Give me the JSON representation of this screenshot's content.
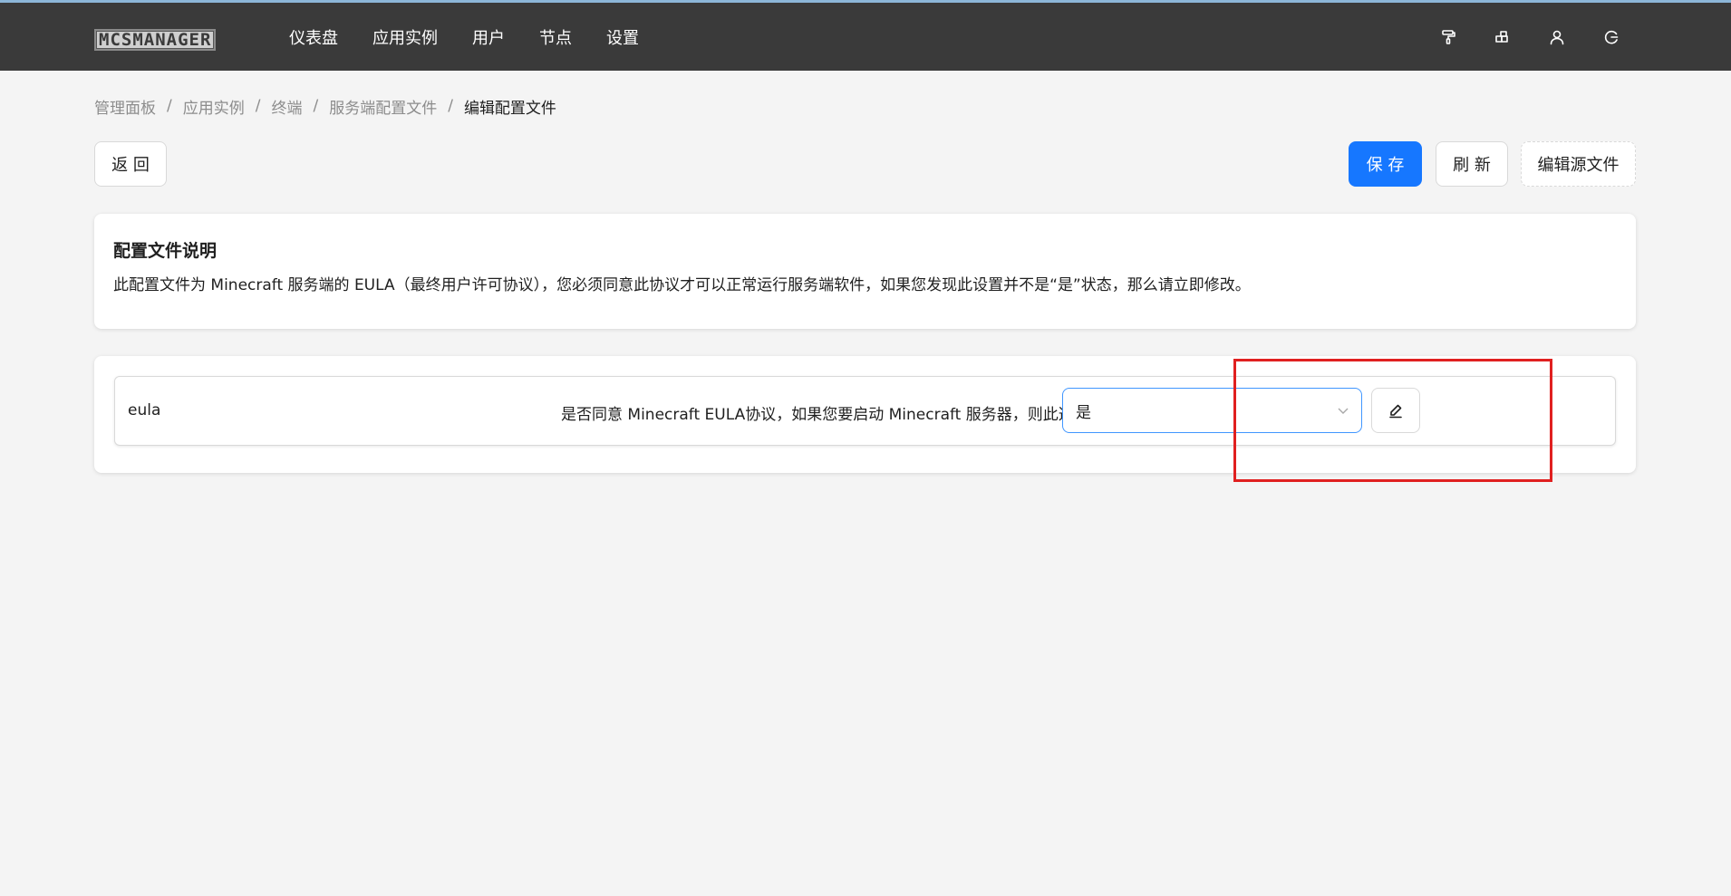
{
  "header": {
    "logo_text": "MCSMANAGER",
    "nav": [
      {
        "label": "仪表盘"
      },
      {
        "label": "应用实例"
      },
      {
        "label": "用户"
      },
      {
        "label": "节点"
      },
      {
        "label": "设置"
      }
    ],
    "tools": [
      {
        "icon": "paint-roller-icon"
      },
      {
        "icon": "puzzle-icon"
      },
      {
        "icon": "user-icon"
      },
      {
        "icon": "logout-icon"
      }
    ]
  },
  "breadcrumb": [
    {
      "label": "管理面板"
    },
    {
      "label": "应用实例"
    },
    {
      "label": "终端"
    },
    {
      "label": "服务端配置文件"
    },
    {
      "label": "编辑配置文件"
    }
  ],
  "breadcrumb_separator": "/",
  "actions": {
    "back_label": "返 回",
    "save_label": "保 存",
    "refresh_label": "刷 新",
    "edit_source_label": "编辑源文件"
  },
  "info": {
    "title": "配置文件说明",
    "description": "此配置文件为 Minecraft 服务端的 EULA（最终用户许可协议），您必须同意此协议才可以正常运行服务端软件，如果您发现此设置并不是“是”状态，那么请立即修改。"
  },
  "config": {
    "items": [
      {
        "key": "eula",
        "description": "是否同意 Minecraft EULA协议，如果您要启动 Minecraft 服务器，则此选项是必须开启",
        "value": "是"
      }
    ]
  },
  "colors": {
    "topbar": "#3a3a3a",
    "primary": "#1677ff",
    "highlight": "#e02020",
    "background": "#f4f4f4"
  }
}
